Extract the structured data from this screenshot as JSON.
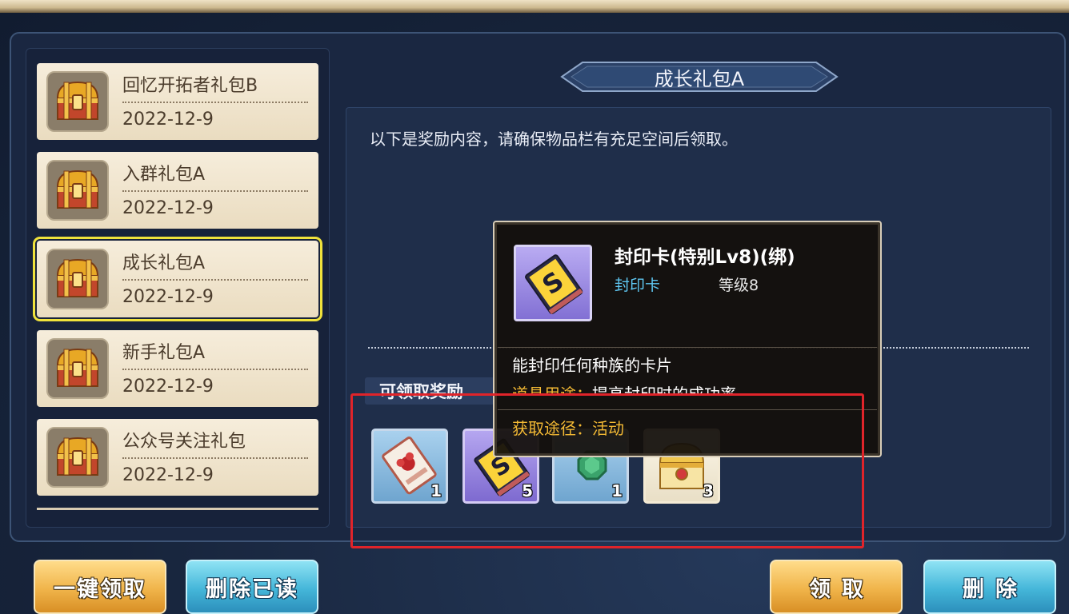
{
  "mail_list": [
    {
      "title": "回忆开拓者礼包B",
      "date": "2022-12-9",
      "icon": "treasure-chest-icon",
      "selected": false
    },
    {
      "title": "入群礼包A",
      "date": "2022-12-9",
      "icon": "treasure-chest-icon",
      "selected": false
    },
    {
      "title": "成长礼包A",
      "date": "2022-12-9",
      "icon": "treasure-chest-icon",
      "selected": true
    },
    {
      "title": "新手礼包A",
      "date": "2022-12-9",
      "icon": "treasure-chest-icon",
      "selected": false
    },
    {
      "title": "公众号关注礼包",
      "date": "2022-12-9",
      "icon": "treasure-chest-icon",
      "selected": false
    }
  ],
  "detail": {
    "title": "成长礼包A",
    "notice": "以下是奖励内容，请确保物品栏有充足空间后领取。",
    "reward_label": "可领取奖励",
    "rewards": [
      {
        "icon": "red-gem-card-icon",
        "count": "1"
      },
      {
        "icon": "seal-card-icon",
        "count": "5"
      },
      {
        "icon": "green-gem-icon",
        "count": "1"
      },
      {
        "icon": "gold-chest-icon",
        "count": "3"
      }
    ]
  },
  "tooltip": {
    "name": "封印卡(特别Lv8)(绑)",
    "type": "封印卡",
    "level": "等级8",
    "description": "能封印任何种族的卡片",
    "use_label": "道具用途：",
    "use_text": "提高封印时的成功率",
    "source": "获取途径：活动",
    "icon": "seal-card-icon"
  },
  "buttons": {
    "claim_all": "一键领取",
    "delete_read": "删除已读",
    "claim": "领取",
    "delete": "删除"
  },
  "colors": {
    "selected_outline": "#f0e23b",
    "highlight_box": "#e0242a",
    "type_text": "#5fc7f2",
    "source_text": "#f3b934"
  }
}
